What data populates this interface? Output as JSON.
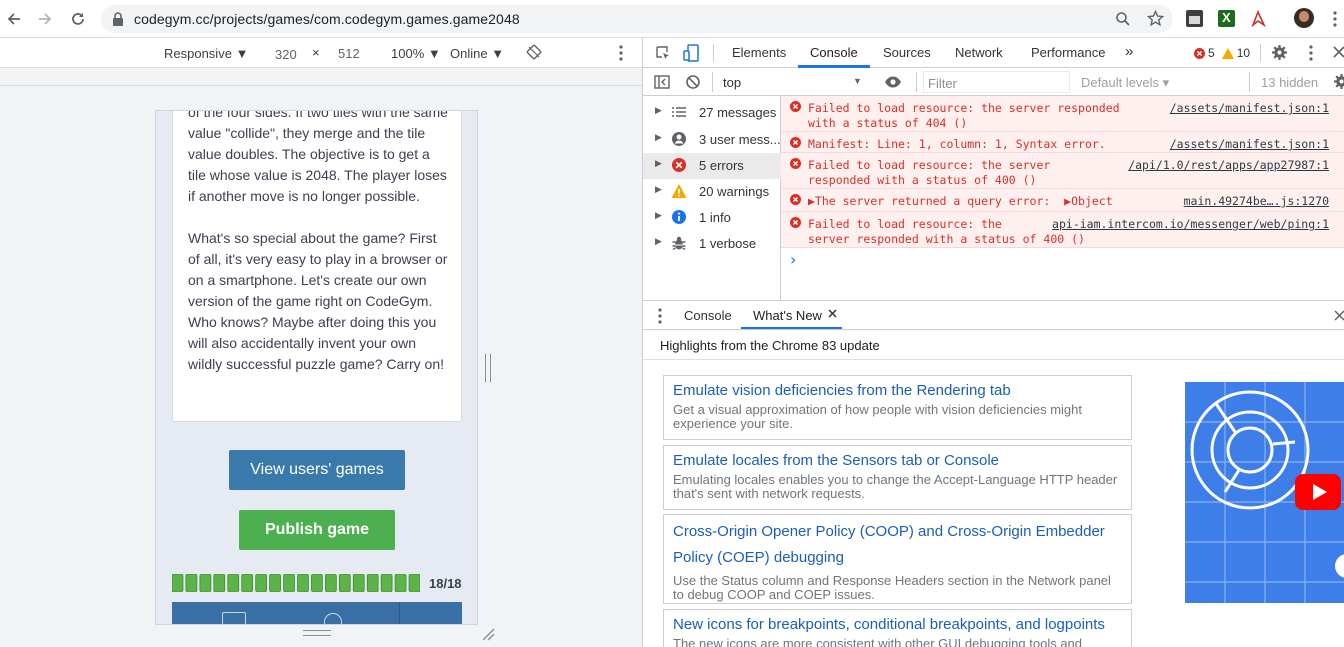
{
  "browser": {
    "url": "codegym.cc/projects/games/com.codegym.games.game2048"
  },
  "device_toolbar": {
    "mode": "Responsive",
    "width": "320",
    "times": "×",
    "height": "512",
    "zoom": "100%",
    "network": "Online"
  },
  "page": {
    "paragraphs": [
      "of the four sides. If two tiles with the same value \"collide\", they merge and the tile value doubles. The objective is to get a tile whose value is 2048. The player loses if another move is no longer possible.",
      "What's so special about the game? First of all, it's very easy to play in a browser or on a smartphone. Let's create our own version of the game right on CodeGym. Who knows? Maybe after doing this you will also accidentally invent your own wildly successful puzzle game? Carry on!"
    ],
    "view_games_label": "View users' games",
    "publish_label": "Publish game",
    "progress": {
      "done": 18,
      "total": 18,
      "label": "18/18"
    },
    "colors": {
      "view_btn": "#3a7aab",
      "publish_btn": "#4caf50",
      "progress": "#5cb346"
    }
  },
  "devtools": {
    "tabs": [
      "Elements",
      "Console",
      "Sources",
      "Network",
      "Performance",
      "»"
    ],
    "active_tab": "Console",
    "error_count": "5",
    "warning_count": "10",
    "context": "top",
    "filter_placeholder": "Filter",
    "levels": "Default levels ▾",
    "hidden": "13 hidden",
    "sidebar": [
      {
        "icon": "list-icon",
        "label": "27 messages"
      },
      {
        "icon": "user-icon",
        "label": "3 user mess..."
      },
      {
        "icon": "error-icon",
        "label": "5 errors"
      },
      {
        "icon": "warning-icon",
        "label": "20 warnings"
      },
      {
        "icon": "info-icon",
        "label": "1 info"
      },
      {
        "icon": "bug-icon",
        "label": "1 verbose"
      }
    ],
    "messages": [
      {
        "text": "Failed to load resource: the server responded\nwith a status of 404 ()",
        "source": "/assets/manifest.json:1"
      },
      {
        "text": "Manifest: Line: 1, column: 1, Syntax error.",
        "source": "/assets/manifest.json:1"
      },
      {
        "text": "Failed to load resource: the server\nresponded with a status of 400 ()",
        "source": "/api/1.0/rest/apps/app27987:1"
      },
      {
        "text": "▶The server returned a query error:  ▶Object",
        "source": "main.49274be….js:1270"
      },
      {
        "text": "Failed to load resource: the\nserver responded with a status of 400 ()",
        "source": "api-iam.intercom.io/messenger/web/ping:1"
      }
    ],
    "prompt": "›",
    "drawer_tabs": [
      "Console",
      "What's New"
    ],
    "whats_new": {
      "header": "Highlights from the Chrome 83 update",
      "items": [
        {
          "title": "Emulate vision deficiencies from the Rendering tab",
          "desc": "Get a visual approximation of how people with vision deficiencies might experience your site."
        },
        {
          "title": "Emulate locales from the Sensors tab or Console",
          "desc": "Emulating locales enables you to change the Accept-Language HTTP header that's sent with network requests."
        },
        {
          "title": "Cross-Origin Opener Policy (COOP) and Cross-Origin Embedder Policy (COEP) debugging",
          "desc": "Use the Status column and Response Headers section in the Network panel to debug COOP and COEP issues."
        },
        {
          "title": "New icons for breakpoints, conditional breakpoints, and logpoints",
          "desc": "The new icons are more consistent with other GUI debugging tools and"
        }
      ]
    }
  }
}
